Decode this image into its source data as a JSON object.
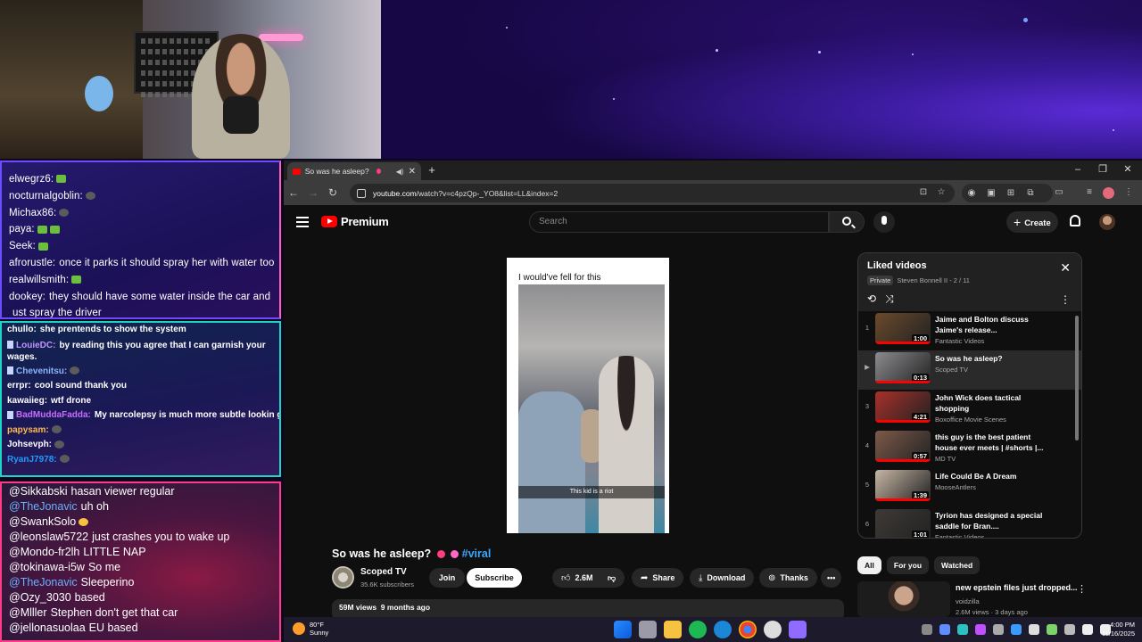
{
  "chat_top": [
    {
      "user": "elwegrz6:",
      "text": "",
      "emotes": [
        "green"
      ]
    },
    {
      "user": "nocturnalgoblin:",
      "text": "",
      "emotes": [
        "dark"
      ]
    },
    {
      "user": "Michax86:",
      "text": "",
      "emotes": [
        "dark"
      ]
    },
    {
      "user": "paya:",
      "text": "",
      "emotes": [
        "green",
        "green"
      ]
    },
    {
      "user": "Seek:",
      "text": "",
      "emotes": [
        "green"
      ]
    },
    {
      "user": "afrorustle:",
      "text": "once it parks it should spray her with water too",
      "emotes": []
    },
    {
      "user": "realwillsmith:",
      "text": "",
      "emotes": [
        "green"
      ]
    },
    {
      "user": "dookey:",
      "text": "they should have some water inside the car and",
      "emotes": []
    },
    {
      "user": "",
      "text": "ust spray the driver",
      "emotes": []
    }
  ],
  "chat_mid": [
    {
      "user": "chullo:",
      "text": "she prentends to show the system",
      "cls": "u1"
    },
    {
      "user": "LouieDC:",
      "text": "by reading this you agree that I can garnish your wages.",
      "cls": "u3",
      "wrap": true,
      "badge": true
    },
    {
      "user": "Chevenitsu:",
      "text": "",
      "cls": "u2",
      "badge": true
    },
    {
      "user": "errpr:",
      "text": "cool sound thank you",
      "cls": "u1"
    },
    {
      "user": "kawaiieg:",
      "text": "wtf drone",
      "cls": "u1"
    },
    {
      "user": "BadMuddaFadda:",
      "text": "My narcolepsy is much more subtle lookin g",
      "cls": "u5",
      "badge": true
    },
    {
      "user": "papysam:",
      "text": "",
      "cls": "u4"
    },
    {
      "user": "Johsevph:",
      "text": "",
      "cls": "u1"
    },
    {
      "user": "RyanJ7978:",
      "text": "",
      "cls": "u6"
    }
  ],
  "chat_bottom": [
    {
      "user": "@Sikkabski",
      "text": "hasan viewer regular",
      "blue": false
    },
    {
      "user": "@TheJonavic",
      "text": "uh oh",
      "blue": true
    },
    {
      "user": "@SwankSolo",
      "text": "",
      "blue": false
    },
    {
      "user": "@leonslaw5722",
      "text": "just crashes you to wake up",
      "blue": false
    },
    {
      "user": "@Mondo-fr2lh",
      "text": "LITTLE NAP",
      "blue": false
    },
    {
      "user": "@tokinawa-i5w",
      "text": "So me",
      "blue": false
    },
    {
      "user": "@TheJonavic",
      "text": "Sleeperino",
      "blue": true
    },
    {
      "user": "@Ozy_3030",
      "text": "based",
      "blue": false
    },
    {
      "user": "@Mlller",
      "text": "Stephen don't get that car",
      "blue": false
    },
    {
      "user": "@jellonasuolaa",
      "text": "EU based",
      "blue": false
    }
  ],
  "browser": {
    "tab_title": "So was he asleep?",
    "url_domain": "youtube.com",
    "url_path": "/watch?v=c4pzQp-_YO8&list=LL&index=2"
  },
  "yt": {
    "logo_word": "Premium",
    "search_placeholder": "Search",
    "create_label": "Create",
    "video_caption": "I would've fell for this",
    "video_subtitle": "This kid is a riot",
    "title": "So was he asleep?",
    "hashtag": "#viral",
    "channel": "Scoped TV",
    "subscribers": "35.6K subscribers",
    "join": "Join",
    "subscribe": "Subscribe",
    "likes": "2.6M",
    "share": "Share",
    "download": "Download",
    "thanks": "Thanks",
    "views": "59M views",
    "age": "9 months ago"
  },
  "playlist": {
    "title": "Liked videos",
    "private": "Private",
    "meta": "Steven Bonnell II - 2 / 11",
    "items": [
      {
        "idx": "1",
        "title": "Jaime and Bolton discuss Jaime's release...",
        "channel": "Fantastic Videos",
        "duration": "1:00",
        "color": "#6b4a2b"
      },
      {
        "idx": "▶",
        "title": "So was he asleep?",
        "channel": "Scoped TV",
        "duration": "0:13",
        "color": "#8c8c90"
      },
      {
        "idx": "3",
        "title": "John Wick does tactical shopping",
        "channel": "Boxoffice Movie Scenes",
        "duration": "4:21",
        "color": "#a9302a"
      },
      {
        "idx": "4",
        "title": "this guy is the best patient house ever meets | #shorts |...",
        "channel": "MD TV",
        "duration": "0:57",
        "color": "#7d5a4a"
      },
      {
        "idx": "5",
        "title": "Life Could Be A Dream",
        "channel": "MooseAntlers",
        "duration": "1:39",
        "color": "#c7b7a5"
      },
      {
        "idx": "6",
        "title": "Tyrion has designed a special saddle for Bran....",
        "channel": "Fantastic Videos",
        "duration": "1:01",
        "color": "#3e3a36"
      }
    ]
  },
  "chips": [
    "All",
    "For you",
    "Watched"
  ],
  "rec": {
    "title": "new epstein files just dropped...",
    "channel": "voidzilla",
    "meta": "2.6M views · 3 days ago"
  },
  "taskbar": {
    "temp": "80°F",
    "weather": "Sunny",
    "time": "4:00 PM",
    "date": "11/16/2025"
  }
}
